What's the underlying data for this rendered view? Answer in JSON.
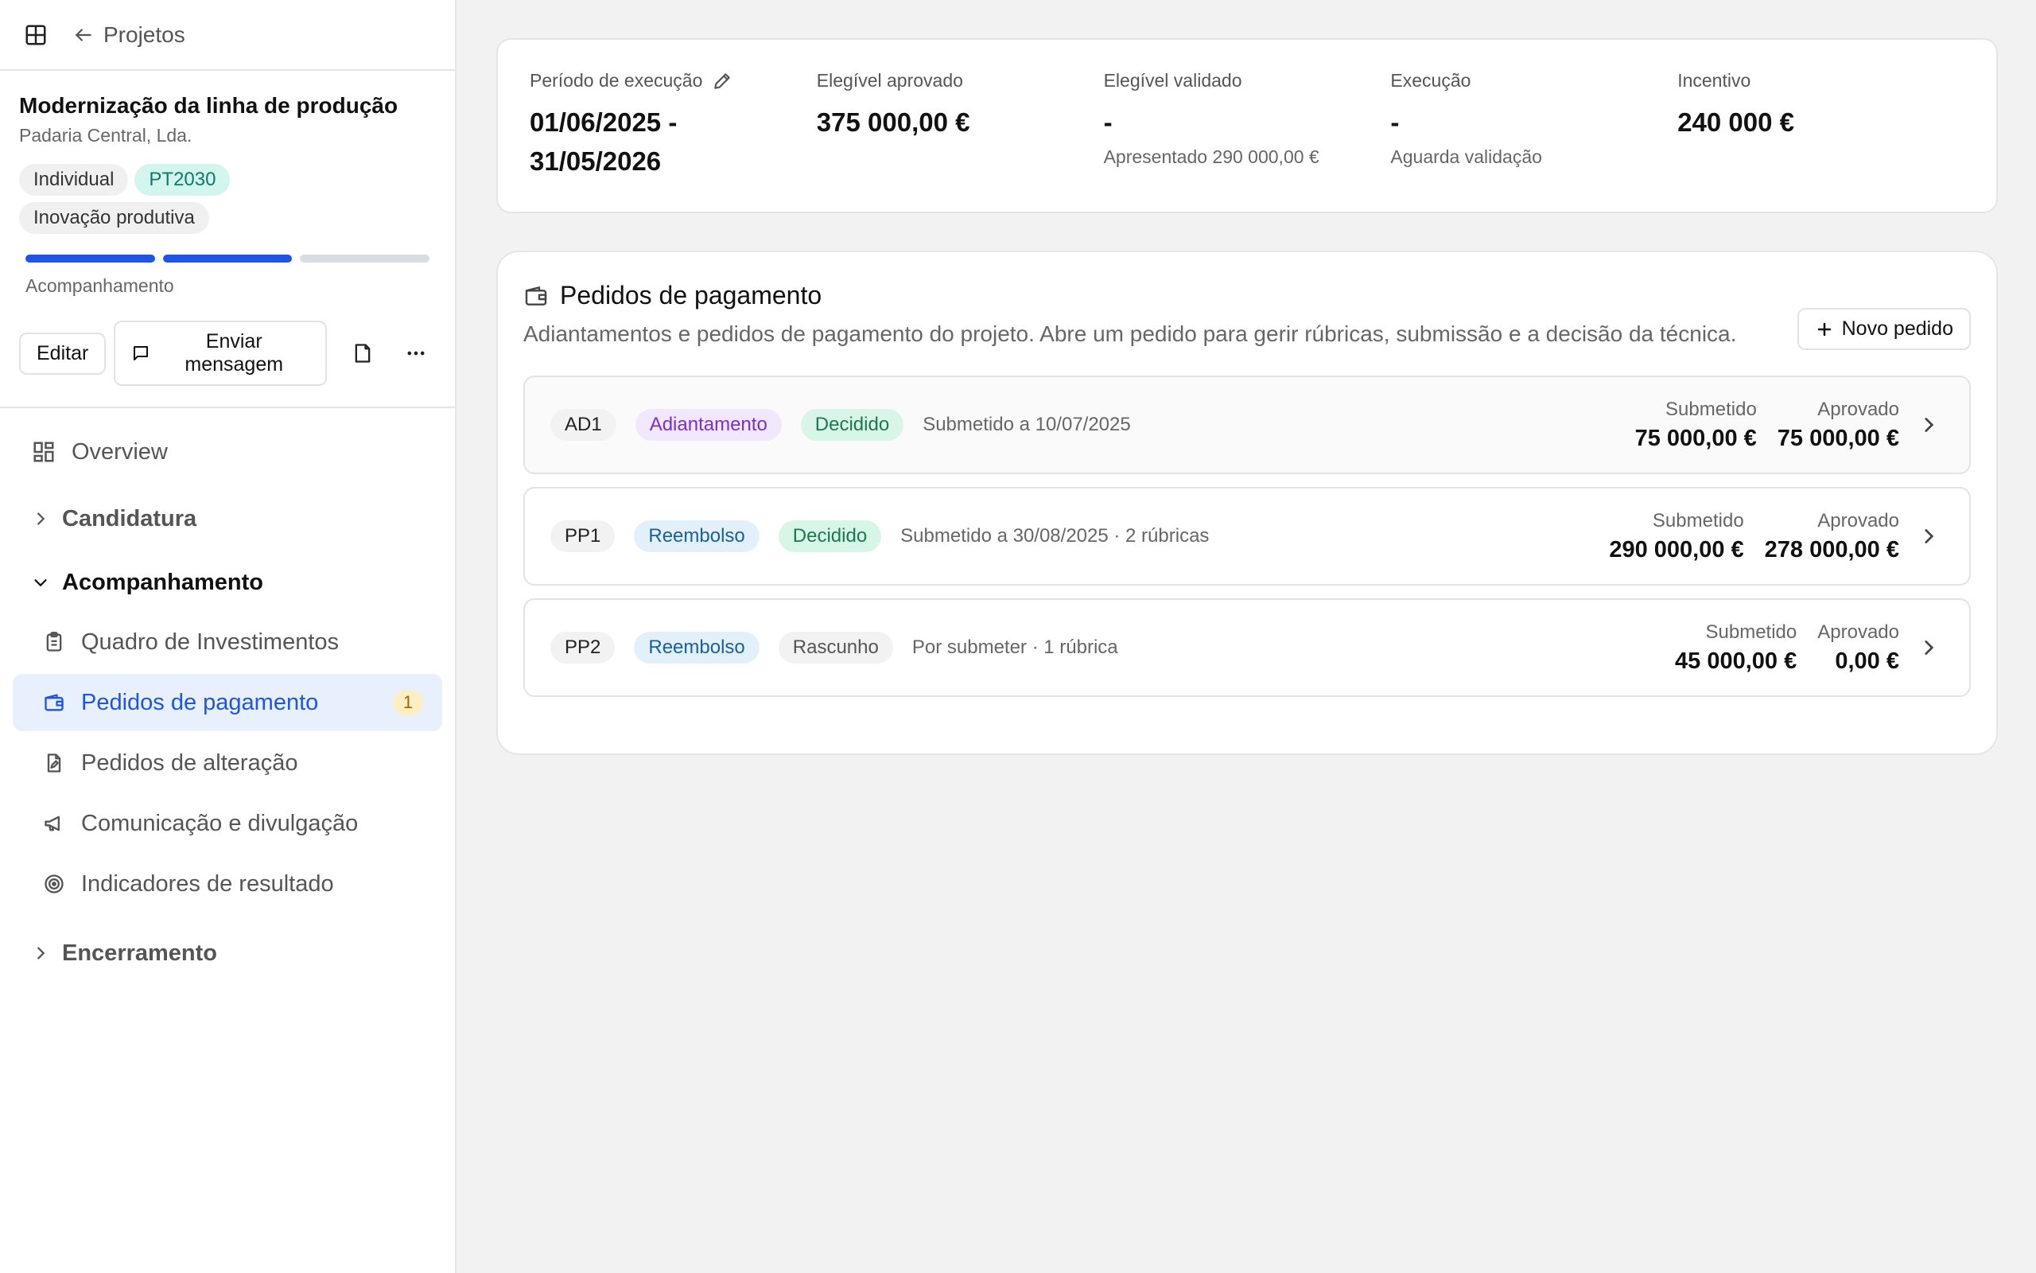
{
  "nav_top": {
    "back_label": "Projetos"
  },
  "project": {
    "title": "Modernização da linha de produção",
    "company": "Padaria Central, Lda.",
    "tags": [
      "Individual",
      "PT2030",
      "Inovação produtiva"
    ],
    "phase": "Acompanhamento",
    "progress_segments": [
      true,
      true,
      false
    ]
  },
  "actions": {
    "edit_label": "Editar",
    "message_label": "Enviar mensagem"
  },
  "sidebar": {
    "overview": "Overview",
    "groups": {
      "candidatura": "Candidatura",
      "acompanhamento": "Acompanhamento",
      "encerramento": "Encerramento"
    },
    "items": [
      {
        "label": "Quadro de Investimentos"
      },
      {
        "label": "Pedidos de pagamento",
        "badge": "1"
      },
      {
        "label": "Pedidos de alteração"
      },
      {
        "label": "Comunicação e divulgação"
      },
      {
        "label": "Indicadores de resultado"
      }
    ]
  },
  "summary": [
    {
      "label": "Período de execução",
      "value": "01/06/2025 - 31/05/2026",
      "note": ""
    },
    {
      "label": "Elegível aprovado",
      "value": "375 000,00 €",
      "note": ""
    },
    {
      "label": "Elegível validado",
      "value": "-",
      "note": "Apresentado 290 000,00 €"
    },
    {
      "label": "Execução",
      "value": "-",
      "note": "Aguarda validação"
    },
    {
      "label": "Incentivo",
      "value": "240 000 €",
      "note": ""
    }
  ],
  "payments": {
    "title": "Pedidos de pagamento",
    "description": "Adiantamentos e pedidos de pagamento do projeto. Abre um pedido para gerir rúbricas, submissão e a decisão da técnica.",
    "new_button": "Novo pedido",
    "submitted_label": "Submetido",
    "approved_label": "Aprovado",
    "rows": [
      {
        "code": "AD1",
        "type": "Adiantamento",
        "status": "Decidido",
        "meta": "Submetido a 10/07/2025",
        "submitted": "75 000,00 €",
        "approved": "75 000,00 €"
      },
      {
        "code": "PP1",
        "type": "Reembolso",
        "status": "Decidido",
        "meta": "Submetido a 30/08/2025 · 2 rúbricas",
        "submitted": "290 000,00 €",
        "approved": "278 000,00 €"
      },
      {
        "code": "PP2",
        "type": "Reembolso",
        "status": "Rascunho",
        "meta": "Por submeter · 1 rúbrica",
        "submitted": "45 000,00 €",
        "approved": "0,00 €"
      }
    ]
  }
}
